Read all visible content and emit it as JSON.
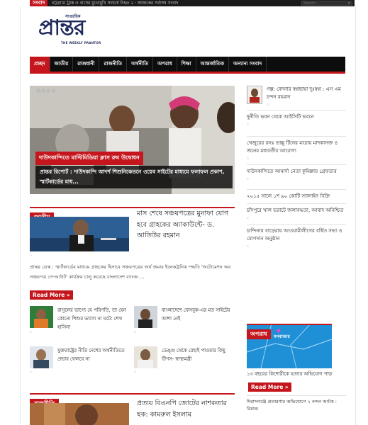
{
  "ticker": {
    "label": "সংবাদ",
    "text": "চট্টগ্রামে ট্রাক ও বাসের মুখোমুখি সংঘর্ষে নিহত ২ · আজকের সর্বশেষ সংবাদ",
    "search_placeholder": "Search..."
  },
  "logo": {
    "kicker": "সাপ্তাহিক",
    "name": "প্রান্তর",
    "tagline": "THE WEEKLY PRANTOR"
  },
  "nav": {
    "items": [
      {
        "label": "প্রচ্ছদ",
        "active": true
      },
      {
        "label": "জাতীয়",
        "active": false
      },
      {
        "label": "রাজধানী",
        "active": false
      },
      {
        "label": "রাজনীতি",
        "active": false
      },
      {
        "label": "অর্থনীতি",
        "active": false
      },
      {
        "label": "অপরাধ",
        "active": false
      },
      {
        "label": "শিক্ষা",
        "active": false
      },
      {
        "label": "আন্তর্জাতিক",
        "active": false
      },
      {
        "label": "অন্যান্য সংবাদ",
        "active": false
      }
    ]
  },
  "hero": {
    "slider_dots": "●●●●",
    "tag": "দাউদকান্দিতে মাল্টিমিডিয়া ক্লাস রুম উদ্বোধন",
    "caption": "প্রান্তর রিপোর্ট : দাউদকান্দি আদর্শ শিশুনিকেতনে ওয়েব সাইটের মাধ্যমে ফলাফল প্রকাশ, স্মার্টকার্ডের মাধ..."
  },
  "sidebar": {
    "feature": {
      "title": "গল্প: বেদনার স্বপ্নছায়া দুঃস্বপ্ন : এস এম চন্দন রহমান",
      "meta": "০"
    },
    "items": [
      {
        "title": "দুর্নীতি ভবন থেকে আইসিটি ভবনে",
        "meta": "০"
      },
      {
        "title": "খেজুরের রসঃ ভাল্লু টিনের মাত্রায় মাদকাসক্ত ৪ জনের মধ্যবর্তীর আরোগ্য",
        "meta": "০"
      },
      {
        "title": "দাউদকান্দিতে আমার্দা নেতা কুমিল্লায় গ্রেফতার",
        "meta": "০"
      },
      {
        "title": "২০১৫ সালে ১শ ৯০ কোটি স্যালাইন বিক্রি",
        "meta": ""
      },
      {
        "title": "চাঁদপুরে খাল ভরাটে জলাবদ্ধতা, আবাদ অনিশ্চিত",
        "meta": "০"
      },
      {
        "title": "চান্দিনায় বাড়েরায় আওয়ামীলীগের বর্ধিত সভা ও যোগদান অনুষ্ঠান",
        "meta": "০"
      }
    ]
  },
  "national": {
    "label": "জাতীয়",
    "lead_title": "মাস শেষে সঞ্চয়পত্রের মুনাফা যোগ হবে গ্রাহকের অ্যাকাউন্টে- ড. আতিউর রহমান",
    "lead_meta": "০",
    "lead_body": "প্রান্তর ডেস্ক : স্মার্টকার্ডের মাধ্যমে গ্রাহকের হিসাবে সঞ্চয়পত্রের অর্থ জমার ইলেকট্রনিক পদ্ধতি 'অটোমেশন অব সঞ্চয়পত্র গে-আউট' কার্যক্রম চালু করেছে বাংলাদেশ ব্যাংক। ...",
    "read_more": "Read More »",
    "minis": [
      {
        "title": "রাসুলের ভাগ্যে যে পরিণতি, তা যেন কোনো শিশুর ভাগ্যে না ঘটে: শেখ হাসিনা",
        "meta": "০"
      },
      {
        "title": "বাংলাদেশে ফেসবুক-এর মত সাইটের আশা নেই",
        "meta": "০"
      },
      {
        "title": "যুক্তরাষ্ট্রের নীতি দেশের অর্থনীতিতে প্রভাব ফেলবে না",
        "meta": "০"
      },
      {
        "title": "ডেঙ্গু থেকে রেহাই পাওয়ার কিছু টিপস- স্বাস্থ্যমন্ত্রী",
        "meta": "০"
      }
    ]
  },
  "crime": {
    "label": "অপরাধ",
    "map_label": "মগবাজার",
    "title": "১৩ বছরের কিশোরীকে হত্যার অভিযোগ পাড়",
    "read_more": "Read More »",
    "item": "দিরাসগঞ্জে প্রতারণার অভিযোগে ২ নন্দন আটক : রিমান্ড"
  },
  "politics": {
    "label": "রাজনীতি",
    "title": "প্রত্যয় বিএনপি জোটের নাশকতার ছক: কামরুল ইসলাম"
  },
  "colors": {
    "accent": "#c4161c",
    "nav_bg": "#0d0d0d",
    "brand": "#1f2a5c"
  }
}
